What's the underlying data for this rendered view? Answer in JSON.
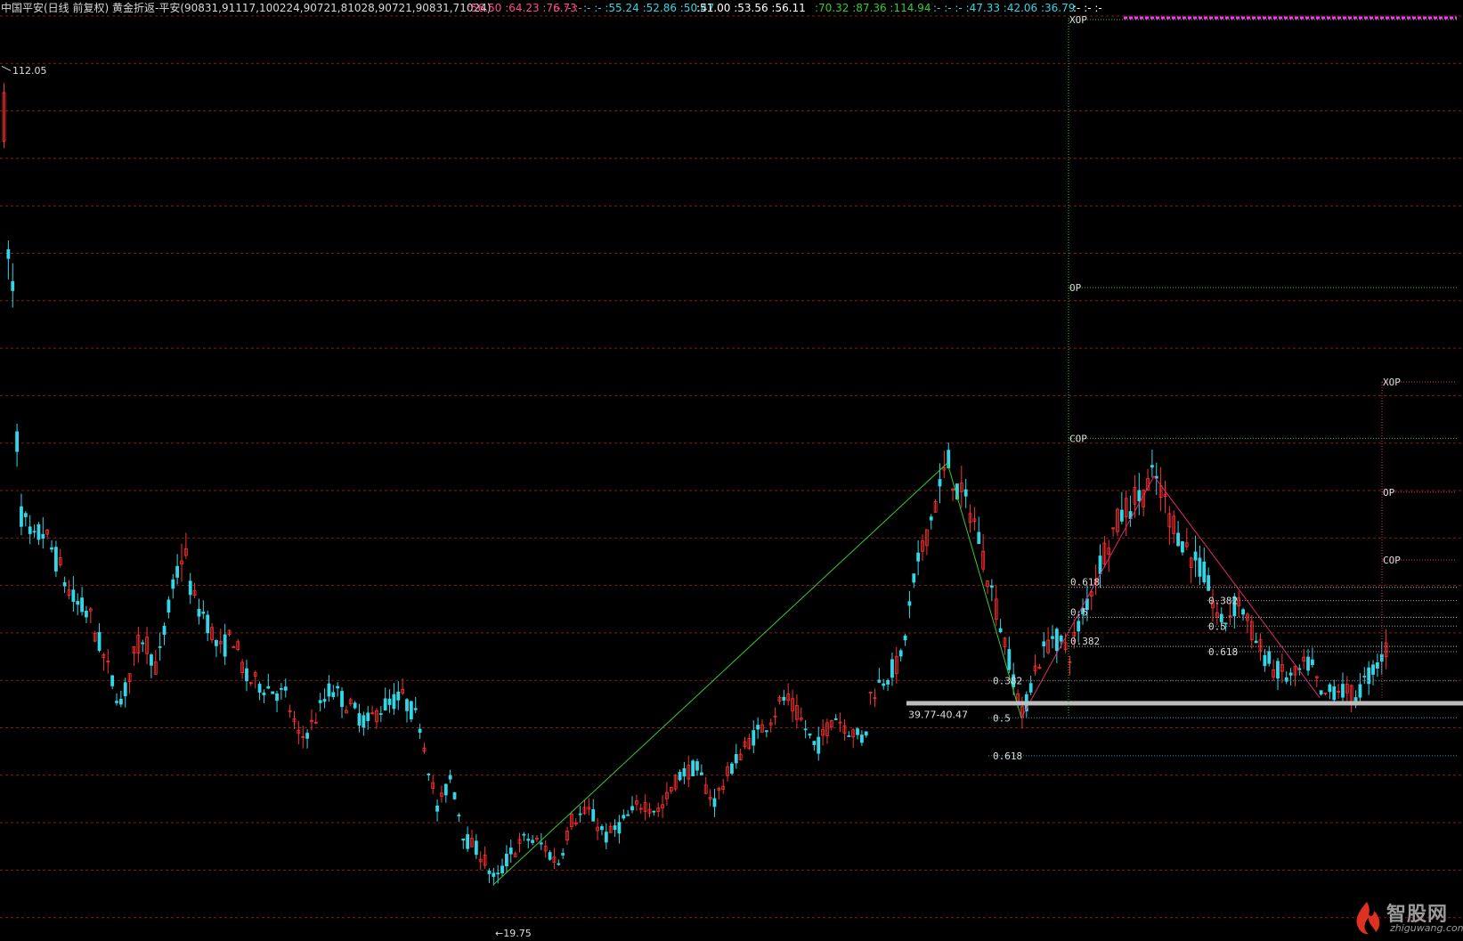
{
  "header": {
    "title": "中国平安(日线 前复权) 黄金折返-平安(90831,91117,100224,90721,81028,90721,90831,71024)",
    "values": [
      {
        "text": ":56.50 :64.23 :76.73",
        "color": "#ff4d8f"
      },
      {
        "text": ":- :- :-",
        "color": "#ff4d8f"
      },
      {
        "text": ":- :- :55.24 :52.86 :50.47",
        "color": "#33d6e6"
      },
      {
        "text": ":51.00 :53.56 :56.11",
        "color": "#ffffff"
      },
      {
        "text": ":70.32 :87.36 :114.94",
        "color": "#33cc33"
      },
      {
        "text": ":- :- :- :47.33 :42.06 :36.79",
        "color": "#33d6e6"
      },
      {
        "text": ":- :- :-",
        "color": "#ffffff"
      }
    ]
  },
  "chart_data": {
    "type": "candlestick",
    "title": "中国平安(日线 前复权)",
    "indicator": "黄金折返-平安",
    "ylim": [
      15,
      118
    ],
    "grid": "horizontal dashed red",
    "annotations": {
      "high_label": "112.05",
      "low_label": "←19.75",
      "zone_label": "39.77-40.47",
      "fib_levels_1": [
        {
          "text": "0.382",
          "value": 42.8
        },
        {
          "text": "0.5",
          "value": 38.6
        },
        {
          "text": "0.618",
          "value": 34.3
        }
      ],
      "fib_levels_2": [
        {
          "text": "0.618",
          "value": 53.4
        },
        {
          "text": "0.5",
          "value": 50.0
        },
        {
          "text": "0.382",
          "value": 46.7
        }
      ],
      "fib_levels_3": [
        {
          "text": "0.382",
          "value": 51.9
        },
        {
          "text": "0.5",
          "value": 49.0
        },
        {
          "text": "0.618",
          "value": 46.1
        }
      ],
      "op_levels_1": [
        {
          "text": "XOP",
          "value": 114.9
        },
        {
          "text": "OP",
          "value": 87.4
        },
        {
          "text": "COP",
          "value": 70.3
        }
      ],
      "op_levels_2": [
        {
          "text": "XOP",
          "value": 76.7
        },
        {
          "text": "OP",
          "value": 64.2
        },
        {
          "text": "COP",
          "value": 56.5
        }
      ],
      "zone_value": 40.2
    },
    "swing_lines": [
      {
        "color": "#33cc33",
        "points": [
          [
            555,
            19.75
          ],
          [
            1064,
            67.5
          ],
          [
            1147,
            38.6
          ]
        ]
      },
      {
        "color": "#e0286e",
        "points": [
          [
            1147,
            38.6
          ],
          [
            1296,
            66.0
          ],
          [
            1482,
            40.9
          ]
        ]
      }
    ],
    "bar_x_range": [
      3,
      1560
    ],
    "bar_count": 320,
    "waypoints": [
      [
        0,
        110
      ],
      [
        4,
        106
      ],
      [
        8,
        90
      ],
      [
        14,
        86
      ],
      [
        18,
        68
      ],
      [
        22,
        62
      ],
      [
        35,
        58
      ],
      [
        45,
        60
      ],
      [
        60,
        57
      ],
      [
        80,
        52
      ],
      [
        100,
        50
      ],
      [
        120,
        44
      ],
      [
        135,
        40
      ],
      [
        150,
        46
      ],
      [
        160,
        48
      ],
      [
        175,
        44
      ],
      [
        190,
        52
      ],
      [
        205,
        58
      ],
      [
        215,
        52
      ],
      [
        230,
        50
      ],
      [
        245,
        46
      ],
      [
        260,
        48
      ],
      [
        275,
        43
      ],
      [
        300,
        42
      ],
      [
        320,
        41
      ],
      [
        335,
        36
      ],
      [
        350,
        38
      ],
      [
        370,
        42
      ],
      [
        390,
        40
      ],
      [
        410,
        38
      ],
      [
        430,
        40
      ],
      [
        450,
        41
      ],
      [
        470,
        38
      ],
      [
        480,
        33
      ],
      [
        490,
        28
      ],
      [
        505,
        32
      ],
      [
        520,
        25
      ],
      [
        540,
        23
      ],
      [
        555,
        19.8
      ],
      [
        570,
        23
      ],
      [
        590,
        25
      ],
      [
        610,
        24
      ],
      [
        625,
        22
      ],
      [
        640,
        27
      ],
      [
        660,
        28
      ],
      [
        680,
        25
      ],
      [
        700,
        27
      ],
      [
        720,
        29
      ],
      [
        740,
        28
      ],
      [
        760,
        32
      ],
      [
        780,
        33
      ],
      [
        800,
        29
      ],
      [
        820,
        33
      ],
      [
        840,
        36
      ],
      [
        860,
        38
      ],
      [
        880,
        41
      ],
      [
        900,
        38
      ],
      [
        915,
        35
      ],
      [
        935,
        39
      ],
      [
        955,
        37
      ],
      [
        970,
        36
      ],
      [
        975,
        41
      ],
      [
        990,
        43
      ],
      [
        1010,
        45
      ],
      [
        1025,
        54
      ],
      [
        1040,
        60
      ],
      [
        1055,
        65
      ],
      [
        1064,
        67.5
      ],
      [
        1075,
        64
      ],
      [
        1090,
        62
      ],
      [
        1105,
        56
      ],
      [
        1120,
        50
      ],
      [
        1135,
        44
      ],
      [
        1147,
        38.6
      ],
      [
        1160,
        44
      ],
      [
        1180,
        48
      ],
      [
        1200,
        46
      ],
      [
        1220,
        52
      ],
      [
        1240,
        58
      ],
      [
        1260,
        62
      ],
      [
        1280,
        64
      ],
      [
        1296,
        66
      ],
      [
        1310,
        62
      ],
      [
        1330,
        58
      ],
      [
        1350,
        55
      ],
      [
        1370,
        49
      ],
      [
        1390,
        52
      ],
      [
        1410,
        47
      ],
      [
        1430,
        44
      ],
      [
        1450,
        43
      ],
      [
        1470,
        45
      ],
      [
        1482,
        40.9
      ],
      [
        1500,
        42
      ],
      [
        1520,
        41
      ],
      [
        1540,
        44
      ],
      [
        1560,
        47
      ]
    ],
    "candle_colors": {
      "up": "#ff3030",
      "down": "#33d6e6"
    }
  },
  "watermark": {
    "word": "智股网",
    "site": "zhiguwang.com"
  }
}
